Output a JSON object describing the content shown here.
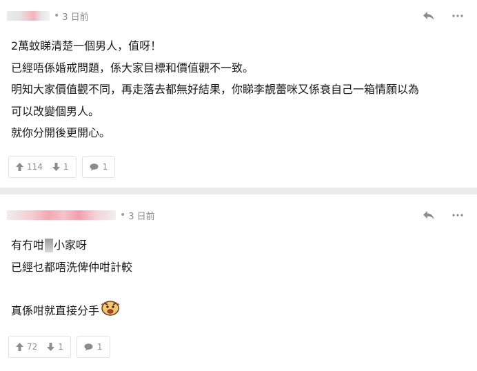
{
  "comments": [
    {
      "username": "",
      "separator": "•",
      "time": "3 日前",
      "lines": [
        "2萬蚊睇清楚一個男人，值呀！",
        "已經唔係婚戒問題，係大家目標和價值觀不一致。",
        "明知大家價值觀不同，再走落去都無好結果，你睇李靚蕾咪又係衰自己一箱情願以為",
        "可以改變個男人。",
        "就你分開後更開心。"
      ],
      "upvotes": "114",
      "downvotes": "1",
      "replies": "1"
    },
    {
      "username": "",
      "separator": "•",
      "time": "3 日前",
      "line1_before": "有冇咁",
      "line1_after": "小家呀",
      "line2": "已經乜都唔洗俾仲咁計較",
      "line4": "真係咁就直接分手",
      "upvotes": "72",
      "downvotes": "1",
      "replies": "1"
    }
  ],
  "icons": {
    "reply": "reply-arrow-icon",
    "more": "more-dots-icon",
    "upvote": "arrow-up-icon",
    "downvote": "arrow-down-icon",
    "comment": "speech-bubble-icon",
    "emoji": "angry-face-sticker-icon"
  },
  "colors": {
    "background": "#ececec",
    "card": "#ffffff",
    "muted_text": "#8a8a8a",
    "icon": "#8c8c8c"
  }
}
